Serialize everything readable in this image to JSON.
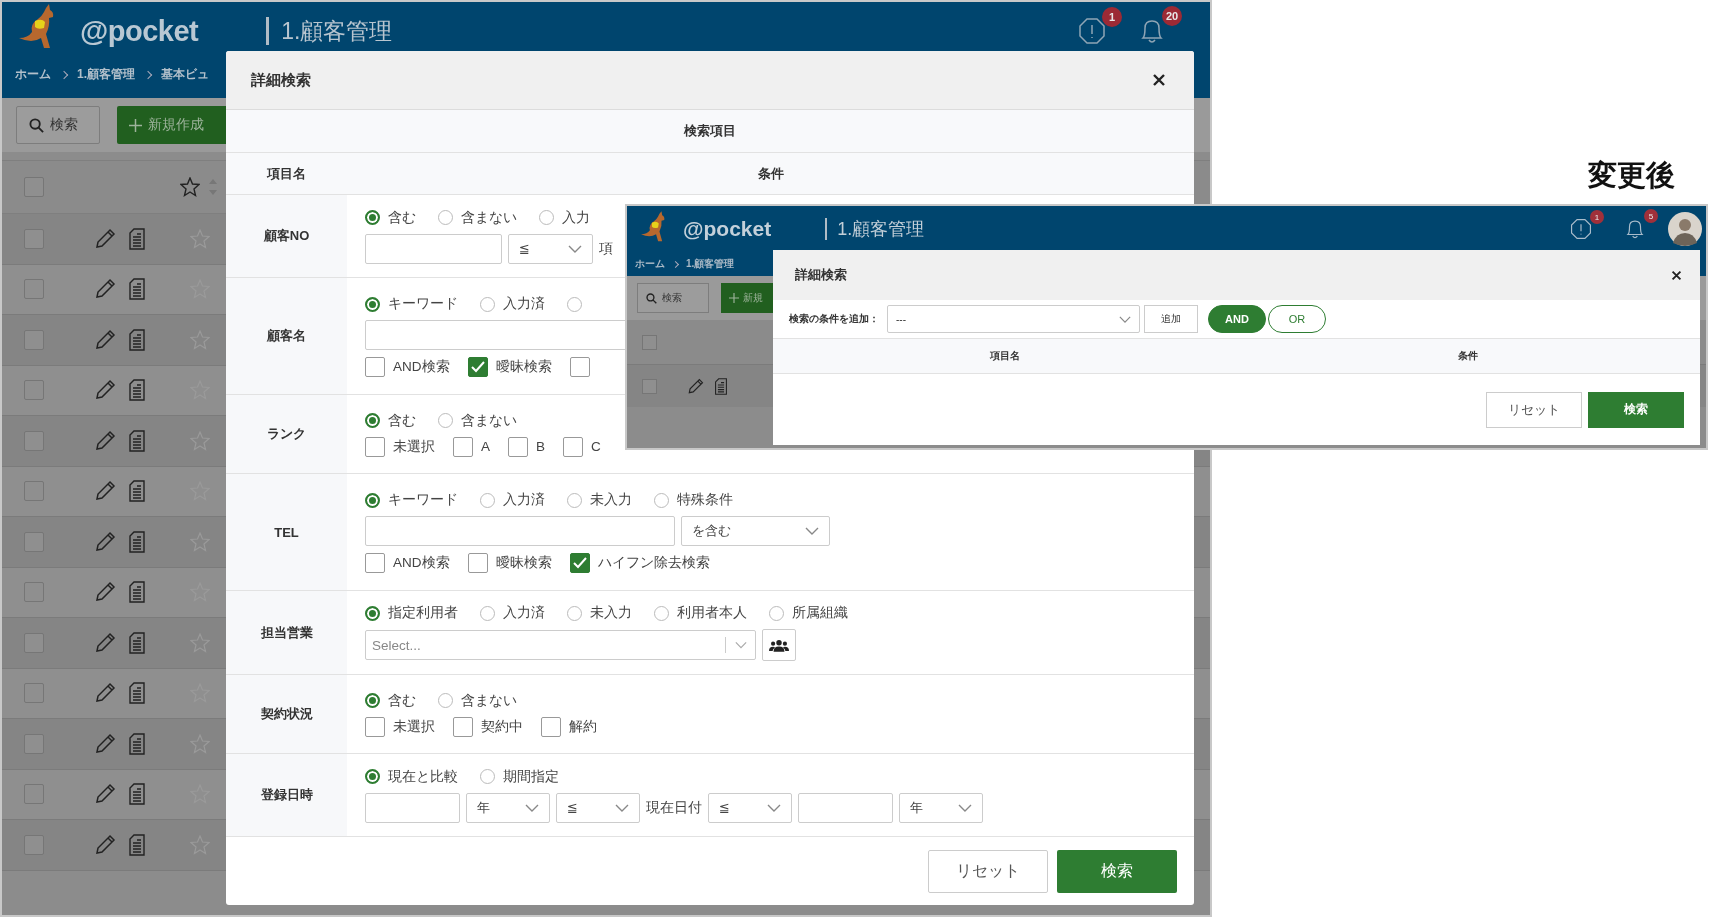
{
  "comparison_label": "変更後",
  "before": {
    "header": {
      "logo": "@pocket",
      "title": "1.顧客管理",
      "alert_badge": "1",
      "bell_badge": "20"
    },
    "breadcrumb": [
      "ホーム",
      "1.顧客管理",
      "基本ビュ"
    ],
    "toolbar": {
      "search_button": "検索",
      "new_button": "新規作成"
    },
    "list_header": {
      "checked": false
    },
    "list_rows": [
      {
        "checked": false
      },
      {
        "checked": false
      },
      {
        "checked": false
      },
      {
        "checked": false
      },
      {
        "checked": false
      },
      {
        "checked": false
      },
      {
        "checked": false
      },
      {
        "checked": false
      },
      {
        "checked": false
      },
      {
        "checked": false
      },
      {
        "checked": false
      },
      {
        "checked": false
      },
      {
        "checked": false
      }
    ],
    "dialog": {
      "title": "詳細検索",
      "section": "検索項目",
      "columns": [
        "項目名",
        "条件"
      ],
      "rows": [
        {
          "label": "顧客NO",
          "lines": [
            {
              "kind": "radios",
              "options": [
                {
                  "label": "含む",
                  "selected": true
                },
                {
                  "label": "含まない",
                  "selected": false
                },
                {
                  "label": "入力",
                  "selected": false
                }
              ]
            },
            {
              "kind": "fields",
              "items": [
                {
                  "kind": "input"
                },
                {
                  "kind": "select",
                  "value": "≦"
                },
                {
                  "kind": "label",
                  "text": "項"
                }
              ]
            }
          ]
        },
        {
          "label": "顧客名",
          "lines": [
            {
              "kind": "radios",
              "options": [
                {
                  "label": "キーワード",
                  "selected": true
                },
                {
                  "label": "入力済",
                  "selected": false
                },
                {
                  "selected": false
                }
              ]
            },
            {
              "kind": "fields",
              "items": [
                {
                  "kind": "input"
                }
              ]
            },
            {
              "kind": "checks",
              "options": [
                {
                  "label": "AND検索",
                  "checked": false
                },
                {
                  "label": "曖昧検索",
                  "checked": true
                },
                {
                  "checked": false
                }
              ]
            }
          ]
        },
        {
          "label": "ランク",
          "lines": [
            {
              "kind": "radios",
              "options": [
                {
                  "label": "含む",
                  "selected": true
                },
                {
                  "label": "含まない",
                  "selected": false
                }
              ]
            },
            {
              "kind": "checks",
              "options": [
                {
                  "label": "未選択",
                  "checked": false
                },
                {
                  "label": "A",
                  "checked": false
                },
                {
                  "label": "B",
                  "checked": false
                },
                {
                  "label": "C",
                  "checked": false
                }
              ]
            }
          ]
        },
        {
          "label": "TEL",
          "lines": [
            {
              "kind": "radios",
              "options": [
                {
                  "label": "キーワード",
                  "selected": true
                },
                {
                  "label": "入力済",
                  "selected": false
                },
                {
                  "label": "未入力",
                  "selected": false
                },
                {
                  "label": "特殊条件",
                  "selected": false
                }
              ]
            },
            {
              "kind": "fields",
              "items": [
                {
                  "kind": "input"
                },
                {
                  "kind": "select",
                  "value": "を含む"
                }
              ]
            },
            {
              "kind": "checks",
              "options": [
                {
                  "label": "AND検索",
                  "checked": false
                },
                {
                  "label": "曖昧検索",
                  "checked": false
                },
                {
                  "label": "ハイフン除去検索",
                  "checked": true
                }
              ]
            }
          ]
        },
        {
          "label": "担当営業",
          "lines": [
            {
              "kind": "radios",
              "options": [
                {
                  "label": "指定利用者",
                  "selected": true
                },
                {
                  "label": "入力済",
                  "selected": false
                },
                {
                  "label": "未入力",
                  "selected": false
                },
                {
                  "label": "利用者本人",
                  "selected": false
                },
                {
                  "label": "所属組織",
                  "selected": false
                }
              ]
            },
            {
              "kind": "fields",
              "items": [
                {
                  "kind": "combo",
                  "placeholder": "Select..."
                },
                {
                  "kind": "people-button"
                }
              ]
            }
          ]
        },
        {
          "label": "契約状況",
          "lines": [
            {
              "kind": "radios",
              "options": [
                {
                  "label": "含む",
                  "selected": true
                },
                {
                  "label": "含まない",
                  "selected": false
                }
              ]
            },
            {
              "kind": "checks",
              "options": [
                {
                  "label": "未選択",
                  "checked": false
                },
                {
                  "label": "契約中",
                  "checked": false
                },
                {
                  "label": "解約",
                  "checked": false
                }
              ]
            }
          ]
        },
        {
          "label": "登録日時",
          "lines": [
            {
              "kind": "radios",
              "options": [
                {
                  "label": "現在と比較",
                  "selected": true
                },
                {
                  "label": "期間指定",
                  "selected": false
                }
              ]
            },
            {
              "kind": "fields",
              "items": [
                {
                  "kind": "input"
                },
                {
                  "kind": "select",
                  "value": "年"
                },
                {
                  "kind": "select",
                  "value": "≦"
                },
                {
                  "kind": "label",
                  "text": "現在日付"
                },
                {
                  "kind": "select",
                  "value": "≦"
                },
                {
                  "kind": "input"
                },
                {
                  "kind": "select",
                  "value": "年"
                }
              ]
            }
          ]
        }
      ],
      "buttons": {
        "reset": "リセット",
        "search": "検索"
      }
    }
  },
  "after": {
    "header": {
      "logo": "@pocket",
      "title": "1.顧客管理",
      "alert_badge": "1",
      "bell_badge": "5"
    },
    "breadcrumb": [
      "ホーム",
      "1.顧客管理"
    ],
    "toolbar": {
      "search_button": "検索",
      "new_button": "新規"
    },
    "list_header": {
      "checked": false
    },
    "list_rows": [
      {
        "checked": false
      }
    ],
    "dialog": {
      "title": "詳細検索",
      "add_label": "検索の条件を追加：",
      "add_select": "---",
      "add_button": "追加",
      "logic": [
        {
          "label": "AND",
          "selected": true
        },
        {
          "label": "OR",
          "selected": false
        }
      ],
      "columns": [
        "項目名",
        "条件"
      ],
      "buttons": {
        "reset": "リセット",
        "search": "検索"
      }
    }
  }
}
